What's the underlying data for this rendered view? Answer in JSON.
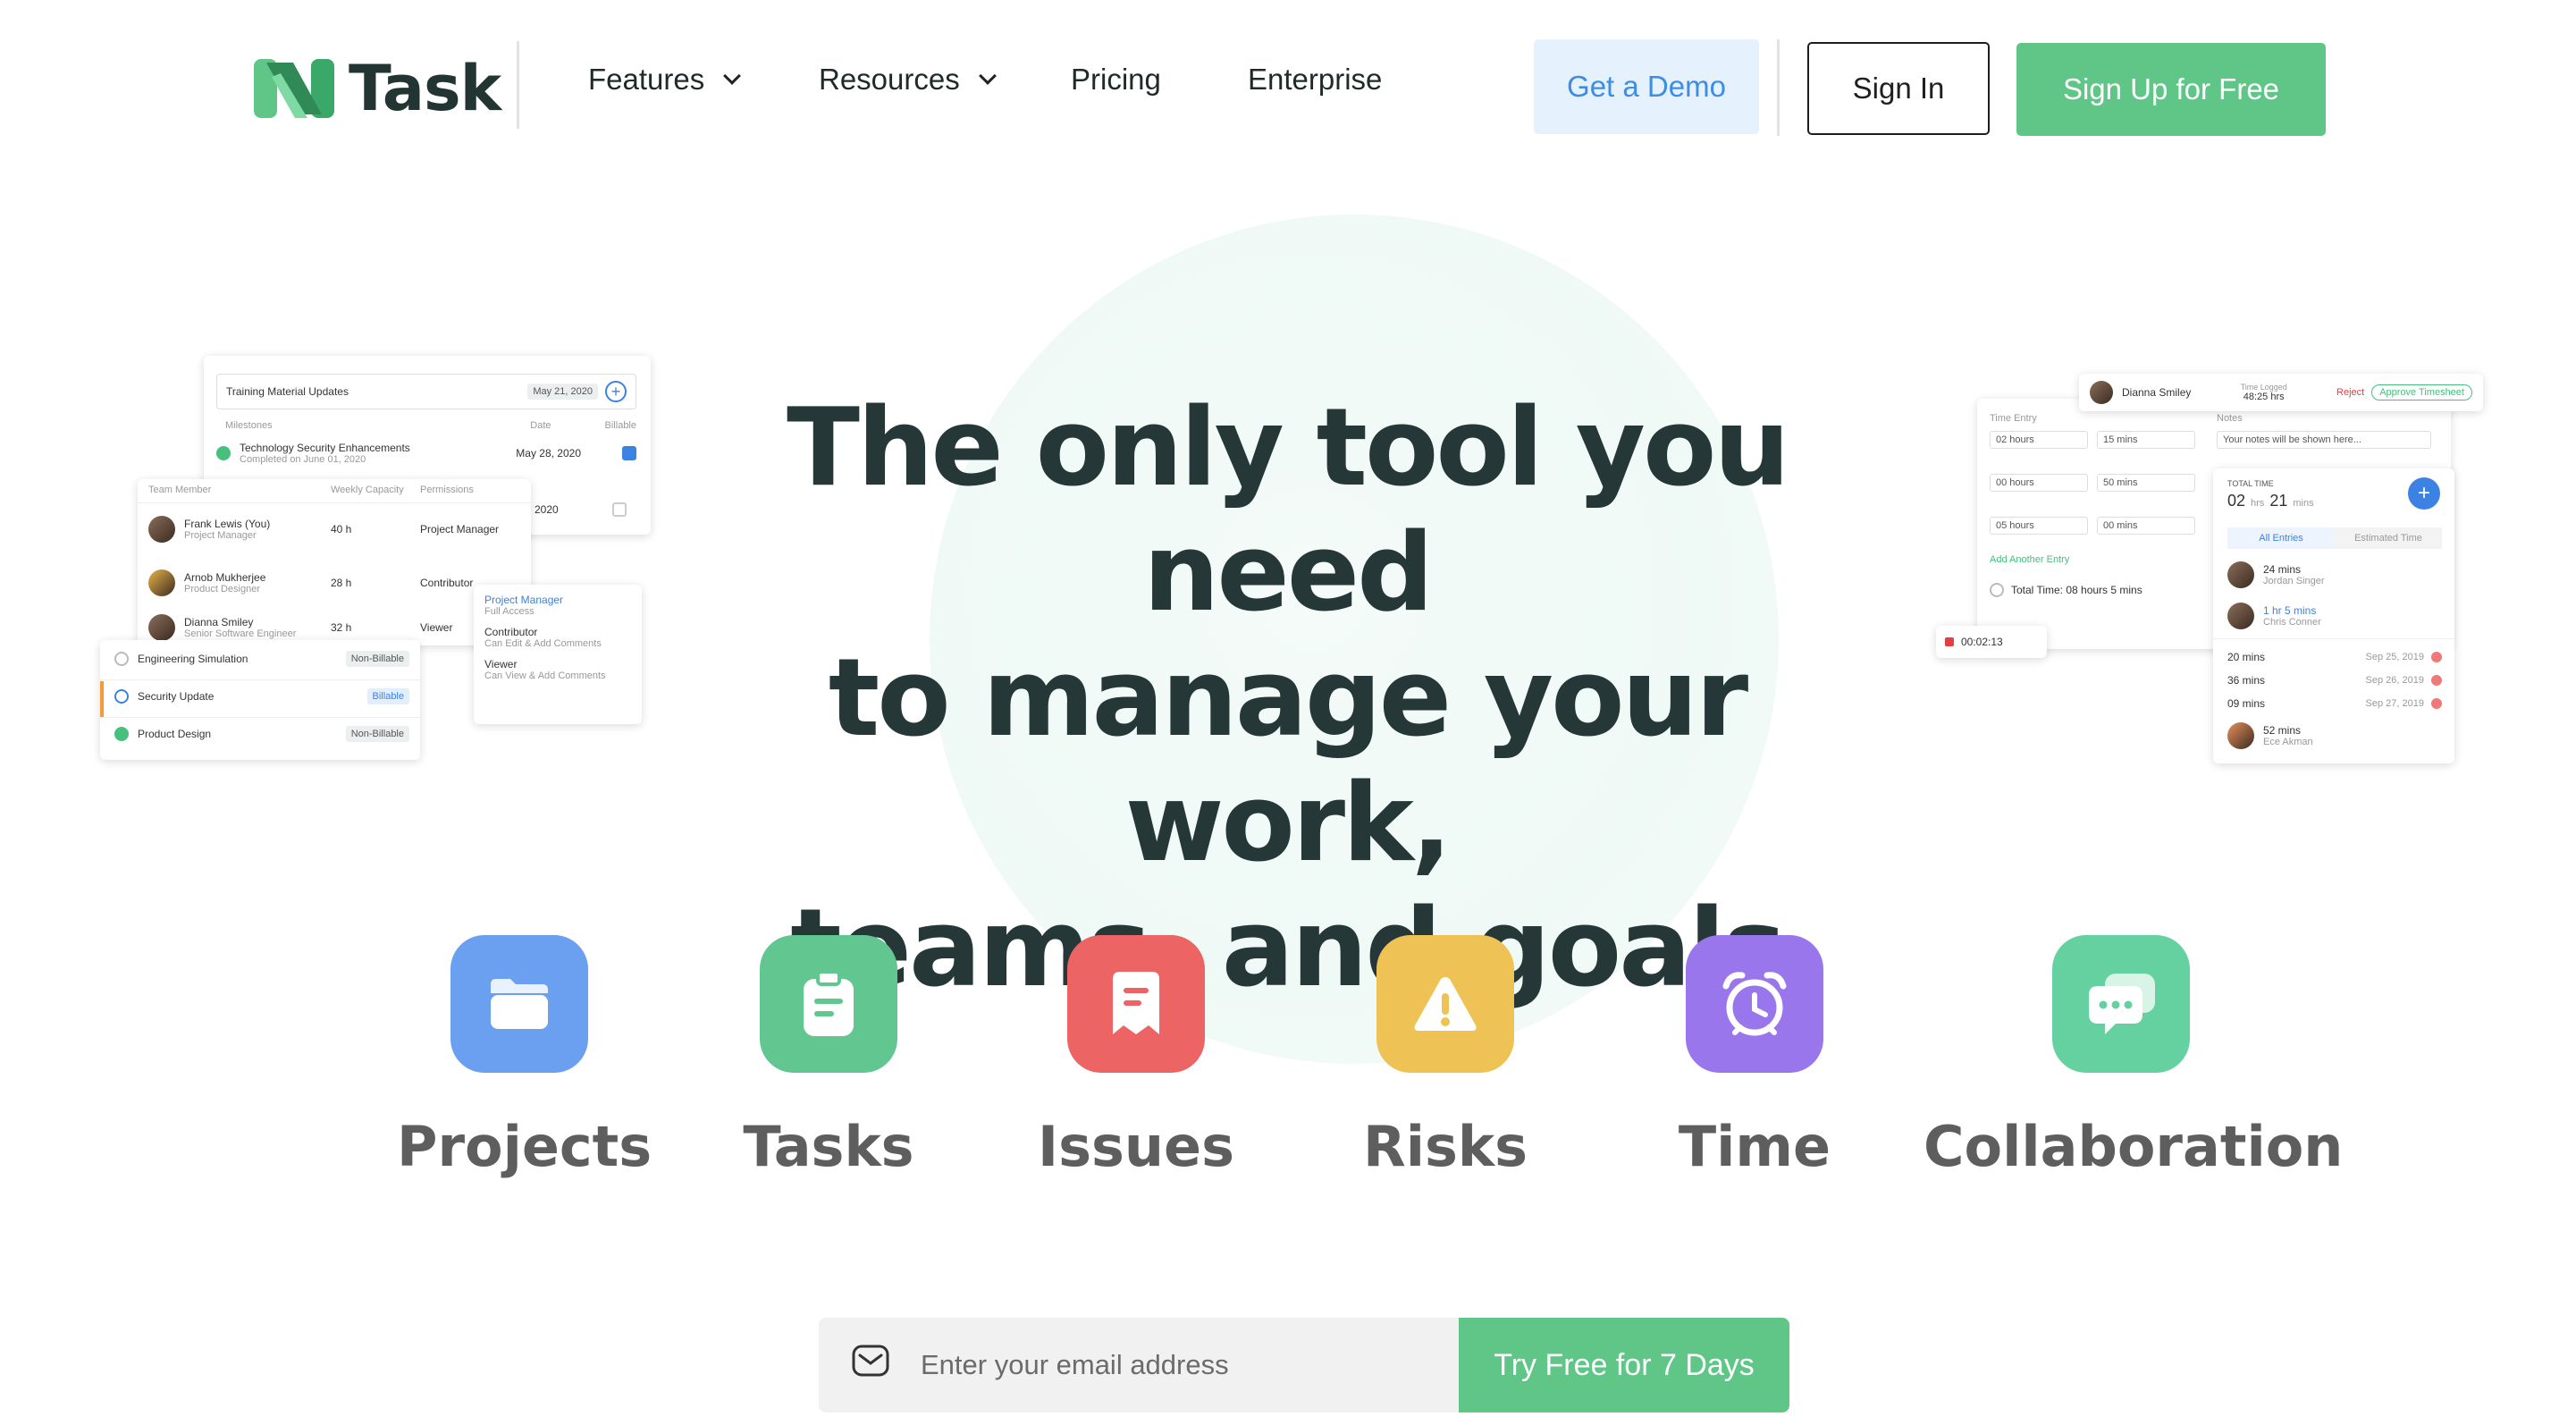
{
  "brand": {
    "name": "Task",
    "mark": "N",
    "colors": {
      "green": "#5fc687",
      "dark": "#233532",
      "blue": "#3c8de4"
    }
  },
  "nav": {
    "features": "Features",
    "resources": "Resources",
    "pricing": "Pricing",
    "enterprise": "Enterprise"
  },
  "actions": {
    "demo": "Get a Demo",
    "signin": "Sign In",
    "signup": "Sign Up for Free"
  },
  "hero": {
    "line1": "The only tool you need",
    "line2": "to manage your work,",
    "line3": "teams, and goals"
  },
  "left_mock": {
    "milestone_title": "Training Material Updates",
    "milestone_date": "May 21, 2020",
    "col_milestones": "Milestones",
    "col_date": "Date",
    "col_billable": "Billable",
    "milestone_row": {
      "name": "Technology Security Enhancements",
      "sub": "Completed on June 01, 2020",
      "date": "May 28, 2020"
    },
    "milestone_row2_date": "2020",
    "team_headers": {
      "member": "Team Member",
      "capacity": "Weekly Capacity",
      "permissions": "Permissions"
    },
    "team": [
      {
        "name": "Frank Lewis (You)",
        "role": "Project Manager",
        "hours": "40 h",
        "perm": "Project Manager"
      },
      {
        "name": "Arnob Mukherjee",
        "role": "Product Designer",
        "hours": "28 h",
        "perm": "Contributor"
      },
      {
        "name": "Dianna Smiley",
        "role": "Senior Software Engineer",
        "hours": "32 h",
        "perm": "Viewer"
      }
    ],
    "perm_menu": [
      {
        "title": "Project Manager",
        "sub": "Full Access"
      },
      {
        "title": "Contributor",
        "sub": "Can Edit & Add Comments"
      },
      {
        "title": "Viewer",
        "sub": "Can View & Add Comments"
      }
    ],
    "tasks": [
      {
        "name": "Engineering Simulation",
        "tag": "Non-Billable"
      },
      {
        "name": "Security Update",
        "tag": "Billable"
      },
      {
        "name": "Product Design",
        "tag": "Non-Billable"
      }
    ]
  },
  "right_mock": {
    "user": "Dianna Smiley",
    "time_logged_label": "Time Logged",
    "time_logged": "48:25 hrs",
    "reject": "Reject",
    "approve": "Approve Timesheet",
    "time_entry_label": "Time Entry",
    "notes_label": "Notes",
    "notes_placeholder": "Your notes will be shown here...",
    "entries": [
      {
        "hours": "02 hours",
        "mins": "15 mins"
      },
      {
        "hours": "00 hours",
        "mins": "50 mins"
      },
      {
        "hours": "05 hours",
        "mins": "00 mins"
      }
    ],
    "add_entry": "Add Another Entry",
    "total_time_text": "Total Time: 08 hours 5 mins",
    "timer": "00:02:13",
    "total_label": "TOTAL TIME",
    "total_hrs": "02",
    "total_hrs_unit": "hrs",
    "total_mins": "21",
    "total_mins_unit": "mins",
    "tab_all": "All Entries",
    "tab_est": "Estimated Time",
    "people": [
      {
        "time": "24 mins",
        "name": "Jordan Singer"
      },
      {
        "time": "1 hr 5 mins",
        "name": "Chris Conner"
      }
    ],
    "logs": [
      {
        "time": "20 mins",
        "date": "Sep 25, 2019"
      },
      {
        "time": "36 mins",
        "date": "Sep 26, 2019"
      },
      {
        "time": "09 mins",
        "date": "Sep 27, 2019"
      }
    ],
    "last_person": {
      "time": "52 mins",
      "name": "Ece Akman"
    }
  },
  "features": [
    {
      "label": "Projects",
      "color": "#6b9ff0",
      "icon": "folder-icon"
    },
    {
      "label": "Tasks",
      "color": "#62c690",
      "icon": "clipboard-icon"
    },
    {
      "label": "Issues",
      "color": "#ec6464",
      "icon": "receipt-icon"
    },
    {
      "label": "Risks",
      "color": "#eec254",
      "icon": "warning-icon"
    },
    {
      "label": "Time",
      "color": "#9a76ec",
      "icon": "alarm-clock-icon"
    },
    {
      "label": "Collaboration",
      "color": "#66d1a0",
      "icon": "chat-bubbles-icon"
    }
  ],
  "signup_bar": {
    "placeholder": "Enter your email address",
    "button": "Try Free for 7 Days"
  }
}
